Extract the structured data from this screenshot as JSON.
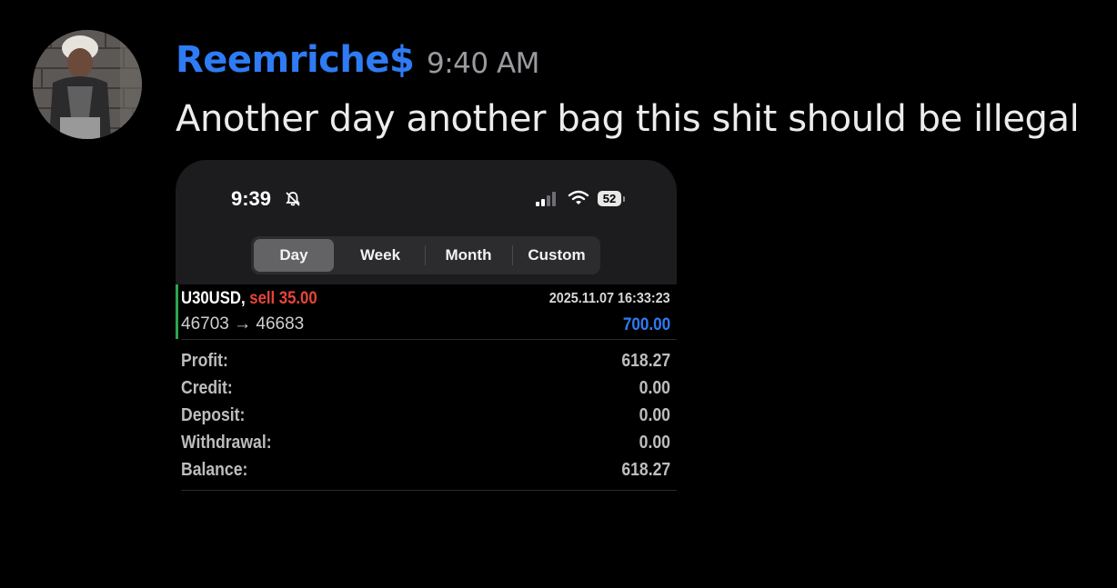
{
  "message": {
    "username": "Reemriche$",
    "timestamp": "9:40 AM",
    "text": "Another day another bag this shit should be illegal",
    "username_color": "#2f7bf5"
  },
  "attachment": {
    "status_bar": {
      "time": "9:39",
      "icons": [
        "bell-slash-icon",
        "cellular-signal-icon",
        "wifi-icon",
        "battery-icon"
      ],
      "battery": "52"
    },
    "period_tabs": [
      {
        "label": "Day",
        "active": true
      },
      {
        "label": "Week",
        "active": false
      },
      {
        "label": "Month",
        "active": false
      },
      {
        "label": "Custom",
        "active": false
      }
    ],
    "trade": {
      "symbol": "U30USD,",
      "side": "sell 35.00",
      "datetime": "2025.11.07 16:33:23",
      "prices": "46703 → 46683",
      "profit": "700.00",
      "side_color": "#e8443a",
      "profit_color": "#2f7bf5",
      "accent_color": "#2ea44f"
    },
    "summary": [
      {
        "label": "Profit:",
        "value": "618.27"
      },
      {
        "label": "Credit:",
        "value": "0.00"
      },
      {
        "label": "Deposit:",
        "value": "0.00"
      },
      {
        "label": "Withdrawal:",
        "value": "0.00"
      },
      {
        "label": "Balance:",
        "value": "618.27"
      }
    ]
  }
}
